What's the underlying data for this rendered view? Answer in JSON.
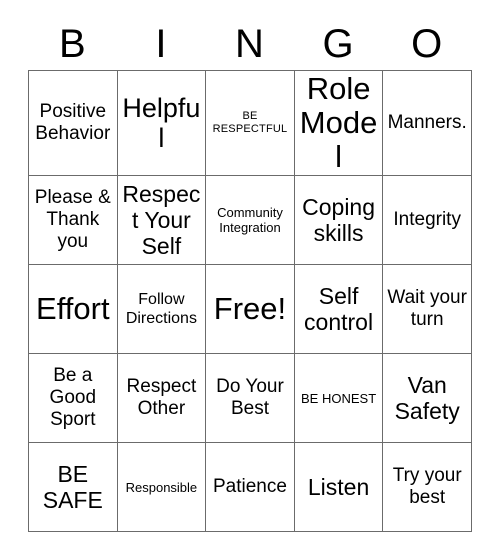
{
  "card": {
    "title": "BINGO",
    "header_letters": [
      "B",
      "I",
      "N",
      "G",
      "O"
    ],
    "grid_size": "5x5",
    "free_space": "Free!",
    "colors": {
      "text": "#000000",
      "grid_line": "#6b6b6b",
      "background": "#ffffff"
    },
    "rows": [
      {
        "cells": [
          {
            "text": "Positive Behavior",
            "size": "fs-m"
          },
          {
            "text": "Helpful",
            "size": "fs-xl"
          },
          {
            "text": "BE RESPECTFUL",
            "size": "fs-xxs"
          },
          {
            "text": "Role Model",
            "size": "fs-xxl"
          },
          {
            "text": "Manners.",
            "size": "fs-m"
          }
        ]
      },
      {
        "cells": [
          {
            "text": "Please & Thank you",
            "size": "fs-m"
          },
          {
            "text": "Respect Your Self",
            "size": "fs-l"
          },
          {
            "text": "Community Integration",
            "size": "fs-xs"
          },
          {
            "text": "Coping skills",
            "size": "fs-l"
          },
          {
            "text": "Integrity",
            "size": "fs-m"
          }
        ]
      },
      {
        "cells": [
          {
            "text": "Effort",
            "size": "fs-xxl"
          },
          {
            "text": "Follow Directions",
            "size": "fs-s"
          },
          {
            "text": "Free!",
            "size": "fs-xxl"
          },
          {
            "text": "Self control",
            "size": "fs-l"
          },
          {
            "text": "Wait your turn",
            "size": "fs-m"
          }
        ]
      },
      {
        "cells": [
          {
            "text": "Be a Good Sport",
            "size": "fs-m"
          },
          {
            "text": "Respect Other",
            "size": "fs-m"
          },
          {
            "text": "Do Your Best",
            "size": "fs-m"
          },
          {
            "text": "BE HONEST",
            "size": "fs-xs"
          },
          {
            "text": "Van Safety",
            "size": "fs-l"
          }
        ]
      },
      {
        "cells": [
          {
            "text": "BE SAFE",
            "size": "fs-l"
          },
          {
            "text": "Responsible",
            "size": "fs-xs"
          },
          {
            "text": "Patience",
            "size": "fs-m"
          },
          {
            "text": "Listen",
            "size": "fs-l"
          },
          {
            "text": "Try your best",
            "size": "fs-m"
          }
        ]
      }
    ]
  }
}
